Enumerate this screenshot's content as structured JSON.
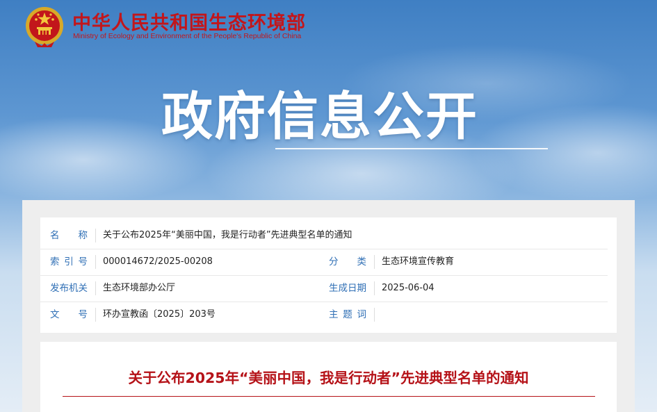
{
  "header": {
    "ministry_name_cn": "中华人民共和国生态环境部",
    "ministry_name_en": "Ministry of Ecology and Environment of the People's Republic of China",
    "logo_icon": "national-emblem-icon"
  },
  "banner": {
    "title": "政府信息公开"
  },
  "metadata": {
    "name": {
      "label": "名称",
      "label_chars": [
        "名",
        "称"
      ],
      "value": "关于公布2025年“美丽中国，我是行动者”先进典型名单的通知"
    },
    "index_no": {
      "label": "索引号",
      "label_chars": [
        "索",
        "引",
        "号"
      ],
      "value": "000014672/2025-00208"
    },
    "category": {
      "label": "分类",
      "label_chars": [
        "分",
        "类"
      ],
      "value": "生态环境宣传教育"
    },
    "issuer": {
      "label": "发布机关",
      "value": "生态环境部办公厅"
    },
    "date": {
      "label": "生成日期",
      "value": "2025-06-04"
    },
    "doc_no": {
      "label": "文号",
      "label_chars": [
        "文",
        "号"
      ],
      "value": "环办宣教函〔2025〕203号"
    },
    "subject": {
      "label": "主题词",
      "label_chars": [
        "主",
        "题",
        "词"
      ],
      "value": ""
    }
  },
  "document": {
    "title": "关于公布2025年“美丽中国，我是行动者”先进典型名单的通知"
  },
  "colors": {
    "brand_red": "#c2161b",
    "label_blue": "#2f6fb5",
    "title_red": "#b51218"
  }
}
